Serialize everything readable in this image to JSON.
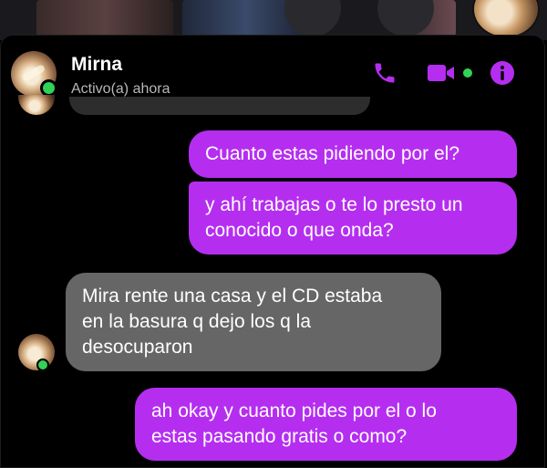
{
  "contact": {
    "name": "Mirna",
    "status": "Activo(a) ahora"
  },
  "icons": {
    "phone": "phone-icon",
    "video": "video-camera-icon",
    "info": "info-icon"
  },
  "colors": {
    "accent": "#b52ef0",
    "online": "#31d256",
    "received_bubble": "#666666"
  },
  "messages": [
    {
      "from": "me",
      "lines": [
        "Cuanto estas pidiendo por el?"
      ]
    },
    {
      "from": "me",
      "lines": [
        "y ahí trabajas o te lo presto un",
        "conocido o que onda?"
      ]
    },
    {
      "from": "contact",
      "lines": [
        "Mira rente una casa y el CD estaba",
        "en la basura q dejo los q la",
        "desocuparon"
      ]
    },
    {
      "from": "me",
      "lines": [
        "ah okay y cuanto pides por el o lo",
        "estas pasando gratis o como?"
      ]
    }
  ]
}
